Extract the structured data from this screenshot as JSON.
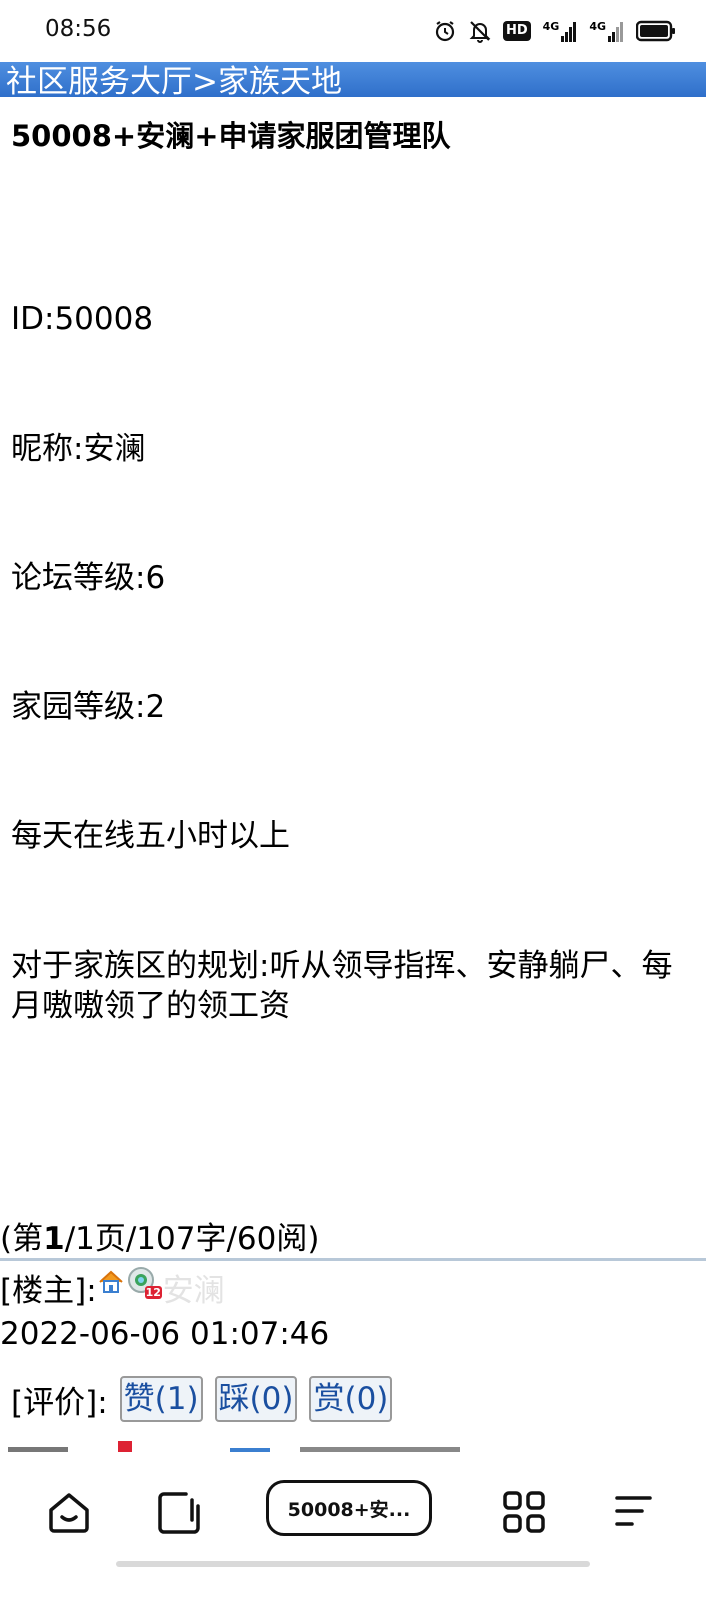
{
  "status_bar": {
    "time": "08:56",
    "icons": [
      "alarm-icon",
      "bell-off-icon",
      "hd-icon",
      "signal-4g-icon",
      "signal-4g-icon",
      "battery-icon"
    ],
    "hd_label": "HD",
    "net_label_1": "4G",
    "net_label_2": "4G"
  },
  "nav": {
    "breadcrumb_home": "社区服务大厅",
    "separator": ">",
    "breadcrumb_current": "家族天地"
  },
  "post": {
    "title": "50008+安澜+申请家服团管理队",
    "lines": [
      "ID:50008",
      "昵称:安澜",
      "论坛等级:6",
      "家园等级:2",
      "每天在线五小时以上",
      "对于家族区的规划:听从领导指挥、安静躺尸、每月嗷嗷领了的领工资"
    ]
  },
  "page_info": {
    "prefix": "(第",
    "page": "1",
    "suffix": "/1页/107字/60阅)"
  },
  "author": {
    "label": "[楼主]:",
    "level_badge": "12",
    "name": "安澜"
  },
  "timestamp": "2022-06-06 01:07:46",
  "rating": {
    "label": "[评价]:",
    "like": "赞(1)",
    "dislike": "踩(0)",
    "reward": "赏(0)"
  },
  "bottom_bar": {
    "tab_title": "50008+安...",
    "icons": [
      "home-icon",
      "tabs-icon",
      "apps-icon",
      "menu-icon"
    ]
  },
  "colors": {
    "nav_bar": "#2f6fca",
    "link": "#1a4fa0",
    "divider": "#b8c8d8"
  }
}
